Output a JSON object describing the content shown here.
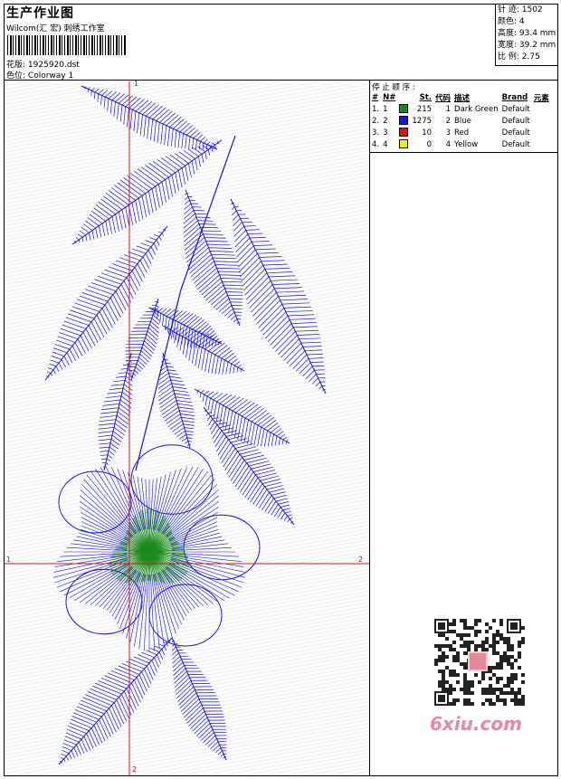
{
  "header": {
    "title": "生产作业图",
    "company": "Wilcom(汇 宏) 刺绣工作室",
    "pattern_label": "花版:",
    "pattern_value": "1925920.dst",
    "colorway_label": "色位:",
    "colorway_value": "Colorway 1"
  },
  "stats": {
    "stitches": "针 迹: 1502",
    "colors": "颜色: 4",
    "height": "高度: 93.4 mm",
    "width": "宽度: 39.2 mm",
    "scale": "比 例: 2.75"
  },
  "stop_sequence": {
    "title": "停 止 顺 序 :",
    "headers": [
      "#",
      "N#",
      "",
      "St.",
      "代码",
      "描述",
      "Brand",
      "元素"
    ],
    "rows": [
      {
        "idx": "1.",
        "n": "1",
        "color": "#1a8a1a",
        "st": "215",
        "code": "1",
        "desc": "Dark Green",
        "brand": "Default"
      },
      {
        "idx": "2.",
        "n": "2",
        "color": "#1616d8",
        "st": "1275",
        "code": "2",
        "desc": "Blue",
        "brand": "Default"
      },
      {
        "idx": "3.",
        "n": "3",
        "color": "#e01010",
        "st": "10",
        "code": "3",
        "desc": "Red",
        "brand": "Default"
      },
      {
        "idx": "4.",
        "n": "4",
        "color": "#f0f000",
        "st": "0",
        "code": "4",
        "desc": "Yellow",
        "brand": "Default"
      }
    ]
  },
  "axes": {
    "top": "1",
    "left": "1",
    "right": "2",
    "bottom": "2"
  },
  "watermark": {
    "site": "6xiu.com"
  },
  "colors": {
    "thread_blue": "#1616d8",
    "thread_green": "#1a8a1a",
    "crosshair": "#e01010"
  }
}
